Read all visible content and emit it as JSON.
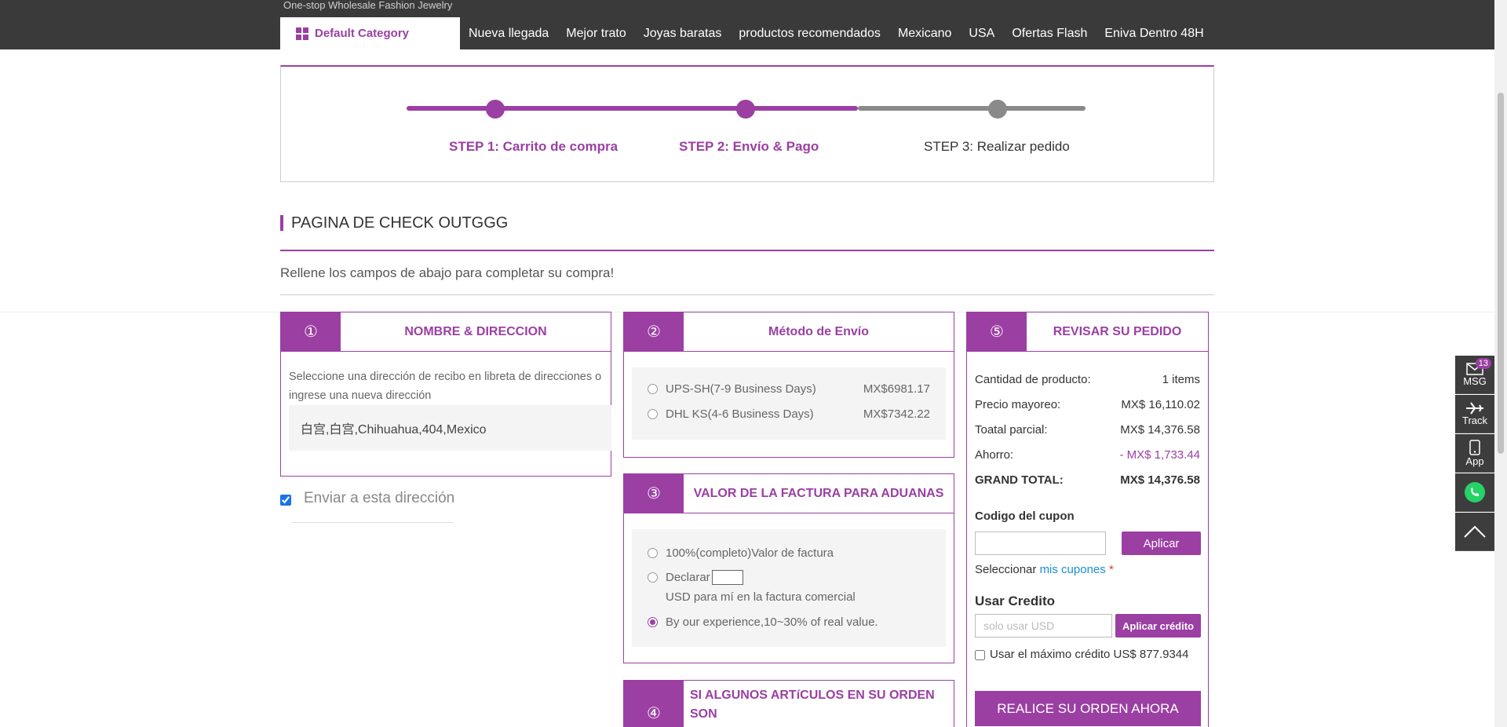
{
  "header": {
    "tagline": "One-stop Wholesale Fashion Jewelry",
    "category_label": "Default Category",
    "nav": [
      "Nueva llegada",
      "Mejor trato",
      "Joyas baratas",
      "productos recomendados",
      "Mexicano",
      "USA",
      "Ofertas Flash",
      "Eniva Dentro 48H"
    ]
  },
  "steps": {
    "step1": "STEP 1: Carrito de compra",
    "step2": "STEP 2: Envío & Pago",
    "step3": "STEP 3: Realizar pedido"
  },
  "page": {
    "title": "PAGINA DE CHECK OUTGGG",
    "subtitle": "Rellene los campos de abajo para completar su compra!"
  },
  "address": {
    "num": "①",
    "title": "NOMBRE & DIRECCION",
    "note": "Seleccione una dirección de recibo en libreta de direcciones o ingrese una nueva dirección",
    "value": "白宫,白宫,Chihuahua,404,Mexico",
    "ship_here": "Enviar a esta dirección"
  },
  "shipping": {
    "num": "②",
    "title": "Método de Envío",
    "options": [
      {
        "label": "UPS-SH(7-9 Business Days)",
        "price": "MX$6981.17"
      },
      {
        "label": "DHL KS(4-6 Business Days)",
        "price": "MX$7342.22"
      }
    ]
  },
  "customs": {
    "num": "③",
    "title": "VALOR DE LA FACTURA PARA ADUANAS",
    "opt_full": "100%(completo)Valor de factura",
    "opt_declare": "Declarar",
    "opt_declare_note": "USD para mí en la factura comercial",
    "opt_experience": "By our experience,10~30% of real value."
  },
  "missing": {
    "num": "④",
    "title": "SI ALGUNOS ARTíCULOS EN SU ORDEN SON"
  },
  "review": {
    "num": "⑤",
    "title": "REVISAR SU PEDIDO",
    "rows": [
      {
        "label": "Cantidad de producto:",
        "value": "1 items"
      },
      {
        "label": "Precio mayoreo:",
        "value": "MX$ 16,110.02"
      },
      {
        "label": "Toatal parcial:",
        "value": "MX$ 14,376.58"
      },
      {
        "label": "Ahorro:",
        "value": "- MX$ 1,733.44"
      },
      {
        "label": "GRAND TOTAL:",
        "value": "MX$ 14,376.58"
      }
    ],
    "coupon_label": "Codigo del cupon",
    "apply_label": "Aplicar",
    "select_label": "Seleccionar",
    "my_coupons": "mis cupones",
    "star": "*",
    "credit_title": "Usar Credito",
    "credit_placeholder": "solo usar USD",
    "apply_credit": "Aplicar crédito",
    "max_credit": "Usar el máximo crédito US$ 877.9344",
    "order_now": "REALICE SU ORDEN AHORA"
  },
  "side": {
    "msg": "MSG",
    "msg_count": "13",
    "track": "Track",
    "app": "App"
  },
  "colors": {
    "accent": "#9b3fa3",
    "nav_bg": "#3a3a3a",
    "link": "#1a8fd6"
  }
}
